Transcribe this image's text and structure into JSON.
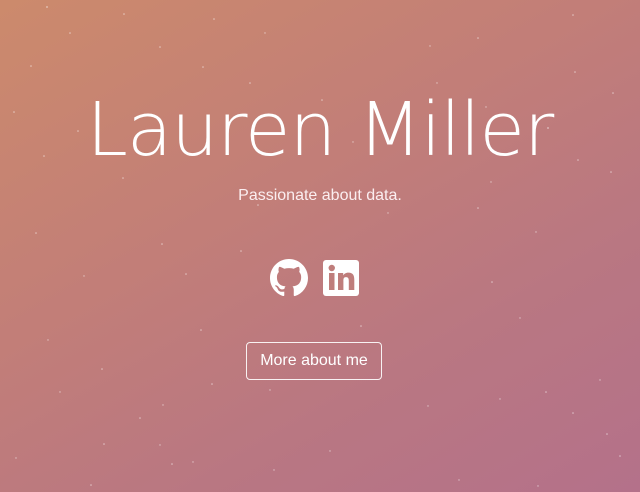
{
  "hero": {
    "name": "Lauren Miller",
    "tagline": "Passionate about data."
  },
  "socials": [
    {
      "icon": "github-icon",
      "label": "GitHub"
    },
    {
      "icon": "linkedin-icon",
      "label": "LinkedIn"
    }
  ],
  "cta": {
    "label": "More about me"
  },
  "colors": {
    "background_start": "#cc8a6c",
    "background_end": "#b4718a",
    "text": "#ffffff"
  }
}
